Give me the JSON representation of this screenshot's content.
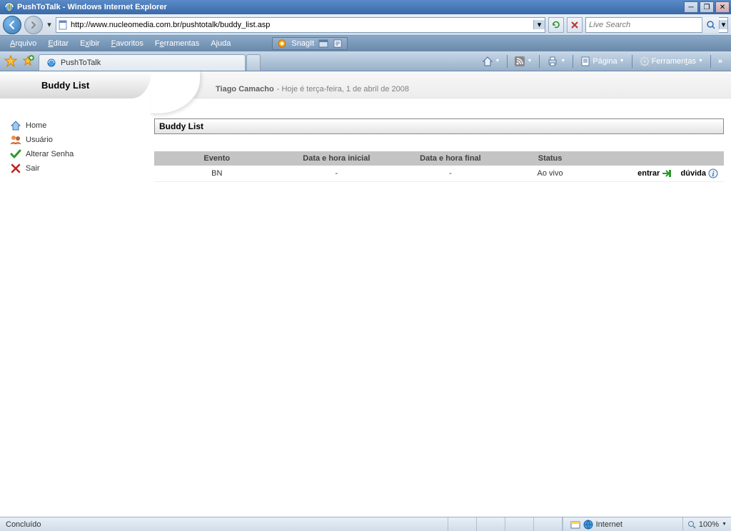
{
  "window": {
    "title": "PushToTalk - Windows Internet Explorer"
  },
  "nav": {
    "address": "http://www.nucleomedia.com.br/pushtotalk/buddy_list.asp",
    "search_placeholder": "Live Search"
  },
  "menu": {
    "arquivo": "Arquivo",
    "editar": "Editar",
    "exibir": "Exibir",
    "favoritos": "Favoritos",
    "ferramentas": "Ferramentas",
    "ajuda": "Ajuda",
    "snagit": "SnagIt"
  },
  "tab": {
    "title": "PushToTalk"
  },
  "cmdbar": {
    "pagina": "Página",
    "ferramentas": "Ferramentas"
  },
  "sidebar": {
    "header": "Buddy List",
    "items": [
      {
        "label": "Home"
      },
      {
        "label": "Usuário"
      },
      {
        "label": "Alterar Senha"
      },
      {
        "label": "Sair"
      }
    ]
  },
  "header": {
    "user": "Tiago Camacho",
    "date_prefix": " - Hoje é terça-feira, 1 de abril de 2008"
  },
  "panel": {
    "title": "Buddy List"
  },
  "table": {
    "headers": {
      "evento": "Evento",
      "inicio": "Data e hora inicial",
      "fim": "Data e hora final",
      "status": "Status"
    },
    "row": {
      "evento": "BN",
      "inicio": "-",
      "fim": "-",
      "status": "Ao vivo",
      "entrar": "entrar",
      "duvida": "dúvida"
    }
  },
  "status": {
    "done": "Concluído",
    "zone": "Internet",
    "zoom": "100%"
  }
}
